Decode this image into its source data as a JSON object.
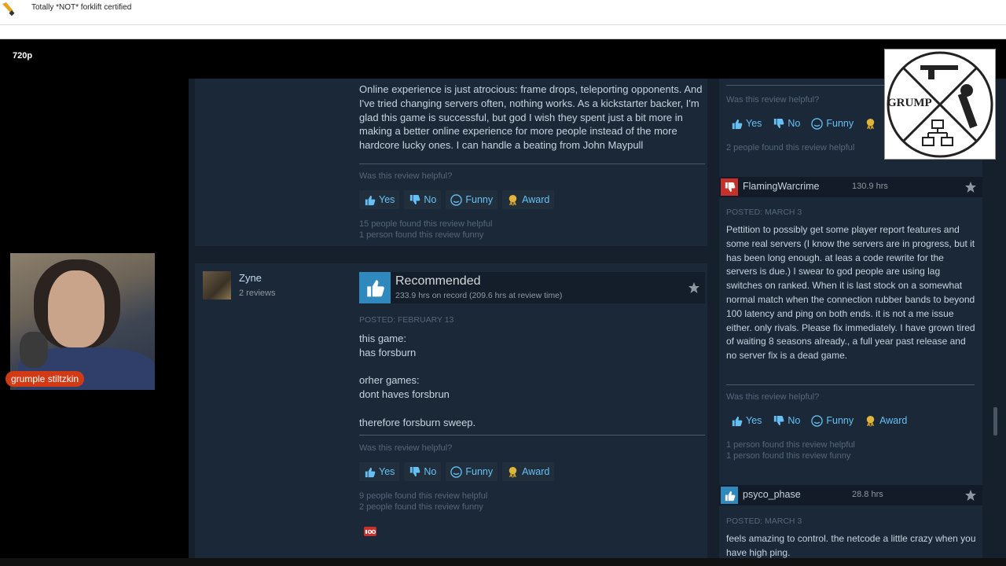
{
  "stream": {
    "title": "Totally *NOT* forklift certified",
    "quality": "720p",
    "webcam_name": "grumple stiltzkin",
    "overlay_logo_text": "GRUMP"
  },
  "colors": {
    "accent": "#66c0f4",
    "recommend_blue": "#2f89bc",
    "not_recommend_red": "#c7312b",
    "page_bg": "#1b2838"
  },
  "buttons": {
    "yes": "Yes",
    "no": "No",
    "funny": "Funny",
    "award": "Award"
  },
  "review1": {
    "text": "Online experience is just atrocious: frame drops, teleporting opponents. And I've tried changing servers often, nothing works. As a kickstarter backer, I'm glad this game is successful, but god I wish they spent just a bit more in making a better online experience for more people instead of the more hardcore lucky ones. I can handle a beating from John Maypull",
    "helpful_prompt": "Was this review helpful?",
    "found_helpful": "15 people found this review helpful",
    "found_funny": "1 person found this review funny"
  },
  "review2": {
    "username": "Zyne",
    "user_reviews": "2 reviews",
    "verdict": "Recommended",
    "hours": "233.9 hrs on record (209.6 hrs at review time)",
    "posted": "Posted: February 13",
    "line1": "this game:",
    "line2": "has forsburn",
    "line3": "orher games:",
    "line4": "dont haves forsbrun",
    "line5": "therefore forsburn sweep.",
    "helpful_prompt": "Was this review helpful?",
    "found_helpful": "9 people found this review helpful",
    "found_funny": "2 people found this review funny"
  },
  "side_review0": {
    "helpful_prompt": "Was this review helpful?",
    "found_helpful": "2 people found this review helpful"
  },
  "side_review1": {
    "username": "FlamingWarcrime",
    "hours": "130.9 hrs",
    "posted": "Posted: March 3",
    "text": "Pettition to possibly get some player report features and some real servers (I know the servers are in progress, but it has been long enough. at leas a code rewrite for the servers is due.) I swear to god people are using lag switches on ranked. When it is last stock on a somewhat normal match when the connection rubber bands to beyond 100 latency and ping on both ends. it is not a me issue either. only rivals. Please fix immediately. I have grown tired of waiting 8 seasons already., a full year past release and no server fix is a dead game.",
    "helpful_prompt": "Was this review helpful?",
    "found_helpful": "1 person found this review helpful",
    "found_funny": "1 person found this review funny"
  },
  "side_review2": {
    "username": "psyco_phase",
    "hours": "28.8 hrs",
    "posted": "Posted: March 3",
    "text": "feels amazing to control. the netcode a little crazy when you have high ping."
  }
}
